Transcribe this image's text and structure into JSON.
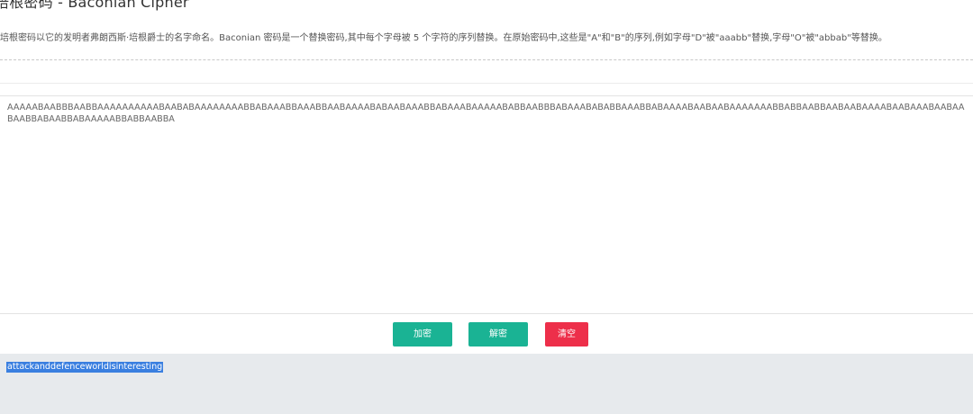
{
  "header": {
    "title": "培根密码 - Baconian Cipher",
    "description": "培根密码以它的发明者弗朗西斯·培根爵士的名字命名。Baconian 密码是一个替换密码,其中每个字母被 5 个字符的序列替换。在原始密码中,这些是\"A\"和\"B\"的序列,例如字母\"D\"被\"aaabb\"替换,字母\"O\"被\"abbab\"等替换。"
  },
  "input": {
    "value": "AAAAABAABBBAABBAAAAAAAAAABAABABAAAAAAAABBABAAABBAAABBAABAAAABABAABAAABBABAAABAAAAABABBAABBBABAAABABABBAAABBABAAAABAABAABAAAAAAABBABBAABBAABAABAAAABAABAAABAABAABAABBABAABBABAAAAABBABBAABBA"
  },
  "buttons": {
    "encrypt": "加密",
    "decrypt": "解密",
    "clear": "清空"
  },
  "result": {
    "text": "attackanddefenceworldisinteresting"
  },
  "colors": {
    "primary": "#1ab394",
    "danger": "#ed2f4a",
    "selection": "#3a7fe0",
    "result_bg": "#e7eaed"
  }
}
